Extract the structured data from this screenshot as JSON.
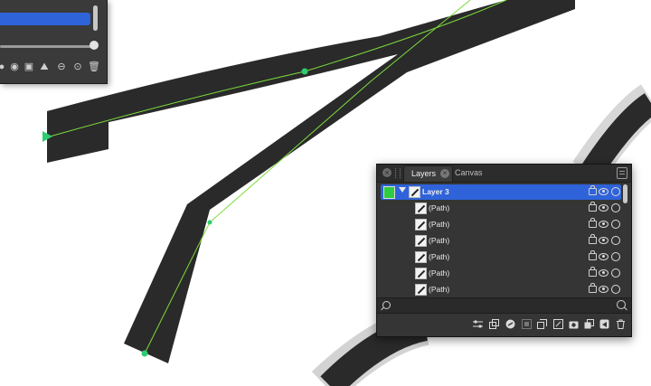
{
  "layers_panel": {
    "tabs": [
      {
        "label": "Layers",
        "active": true
      },
      {
        "label": "Canvas",
        "active": false
      }
    ],
    "layers": [
      {
        "label": "Layer 3",
        "selected": true,
        "color": "#2ecc40"
      },
      {
        "label": "(Path)"
      },
      {
        "label": "(Path)"
      },
      {
        "label": "(Path)"
      },
      {
        "label": "(Path)"
      },
      {
        "label": "(Path)"
      },
      {
        "label": "(Path)"
      }
    ],
    "search": {
      "value": ""
    },
    "toolbar_icons": [
      "adjustments-icon",
      "duplicate-icon",
      "fx-icon",
      "mask-icon",
      "group-icon",
      "vector-icon",
      "camera-icon",
      "layer-icon",
      "send-icon",
      "trash-icon"
    ]
  },
  "colors": {
    "selection": "#2f63d9",
    "stroke_dark": "#2a2a2a",
    "guide_line": "#7ddc3c",
    "node": "#2ecc71"
  }
}
